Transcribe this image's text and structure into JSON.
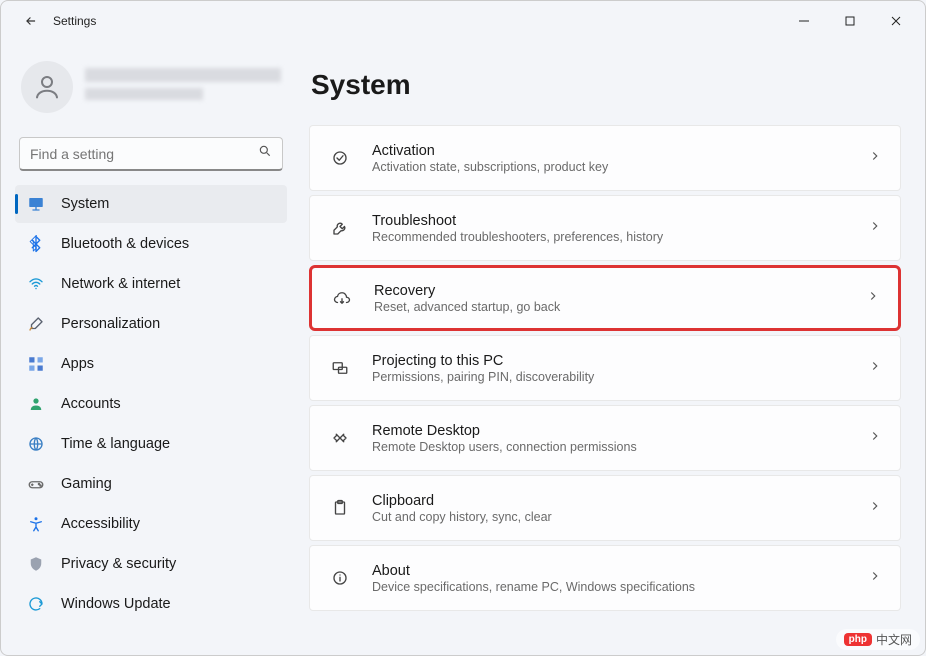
{
  "window": {
    "title": "Settings"
  },
  "search": {
    "placeholder": "Find a setting"
  },
  "page_heading": "System",
  "sidebar": {
    "items": [
      {
        "label": "System",
        "icon": "display",
        "active": true
      },
      {
        "label": "Bluetooth & devices",
        "icon": "bluetooth",
        "active": false
      },
      {
        "label": "Network & internet",
        "icon": "wifi",
        "active": false
      },
      {
        "label": "Personalization",
        "icon": "brush",
        "active": false
      },
      {
        "label": "Apps",
        "icon": "grid",
        "active": false
      },
      {
        "label": "Accounts",
        "icon": "person",
        "active": false
      },
      {
        "label": "Time & language",
        "icon": "globe",
        "active": false
      },
      {
        "label": "Gaming",
        "icon": "gamepad",
        "active": false
      },
      {
        "label": "Accessibility",
        "icon": "accessibility",
        "active": false
      },
      {
        "label": "Privacy & security",
        "icon": "shield",
        "active": false
      },
      {
        "label": "Windows Update",
        "icon": "update",
        "active": false
      }
    ]
  },
  "cards": [
    {
      "title": "Activation",
      "subtitle": "Activation state, subscriptions, product key",
      "icon": "check",
      "highlight": false
    },
    {
      "title": "Troubleshoot",
      "subtitle": "Recommended troubleshooters, preferences, history",
      "icon": "wrench",
      "highlight": false
    },
    {
      "title": "Recovery",
      "subtitle": "Reset, advanced startup, go back",
      "icon": "recovery",
      "highlight": true
    },
    {
      "title": "Projecting to this PC",
      "subtitle": "Permissions, pairing PIN, discoverability",
      "icon": "project",
      "highlight": false
    },
    {
      "title": "Remote Desktop",
      "subtitle": "Remote Desktop users, connection permissions",
      "icon": "remote",
      "highlight": false
    },
    {
      "title": "Clipboard",
      "subtitle": "Cut and copy history, sync, clear",
      "icon": "clipboard",
      "highlight": false
    },
    {
      "title": "About",
      "subtitle": "Device specifications, rename PC, Windows specifications",
      "icon": "info",
      "highlight": false
    }
  ],
  "watermark": {
    "brand": "php",
    "text": "中文网"
  }
}
